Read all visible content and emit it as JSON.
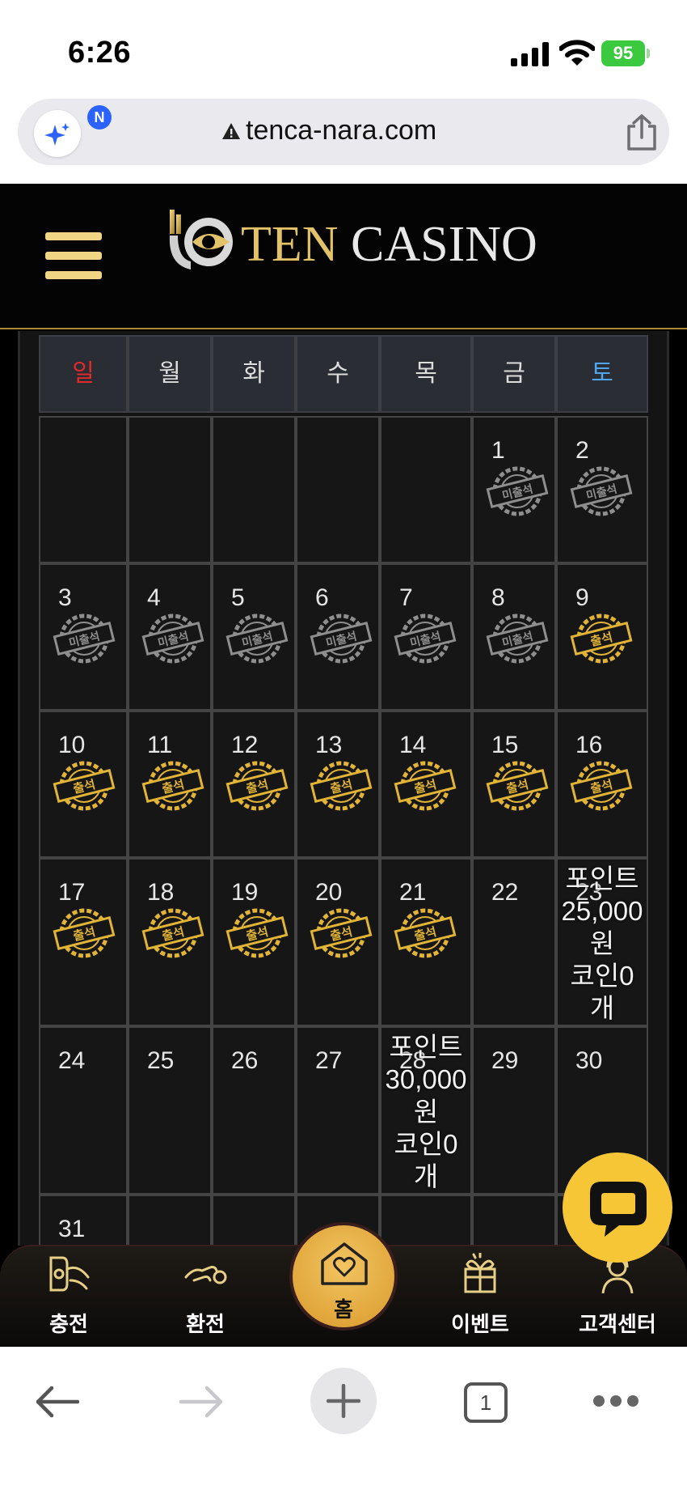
{
  "status_bar": {
    "time": "6:26",
    "battery": "95"
  },
  "browser": {
    "url": "tenca-nara.com",
    "ai_badge": "N"
  },
  "site": {
    "logo_ten": "TEN",
    "logo_casino": "CASINO"
  },
  "calendar": {
    "weekdays": [
      {
        "label": "일",
        "color": "#e02a2a"
      },
      {
        "label": "월",
        "color": "#dddddd"
      },
      {
        "label": "화",
        "color": "#dddddd"
      },
      {
        "label": "수",
        "color": "#dddddd"
      },
      {
        "label": "목",
        "color": "#dddddd"
      },
      {
        "label": "금",
        "color": "#dddddd"
      },
      {
        "label": "토",
        "color": "#4fa6ee"
      }
    ],
    "stamp_attended": "출석",
    "stamp_absent": "미출석",
    "weeks": [
      [
        {
          "day": ""
        },
        {
          "day": ""
        },
        {
          "day": ""
        },
        {
          "day": ""
        },
        {
          "day": ""
        },
        {
          "day": "1",
          "status": "absent"
        },
        {
          "day": "2",
          "status": "absent"
        }
      ],
      [
        {
          "day": "3",
          "status": "absent"
        },
        {
          "day": "4",
          "status": "absent"
        },
        {
          "day": "5",
          "status": "absent"
        },
        {
          "day": "6",
          "status": "absent"
        },
        {
          "day": "7",
          "status": "absent"
        },
        {
          "day": "8",
          "status": "absent"
        },
        {
          "day": "9",
          "status": "attended"
        }
      ],
      [
        {
          "day": "10",
          "status": "attended"
        },
        {
          "day": "11",
          "status": "attended"
        },
        {
          "day": "12",
          "status": "attended"
        },
        {
          "day": "13",
          "status": "attended"
        },
        {
          "day": "14",
          "status": "attended"
        },
        {
          "day": "15",
          "status": "attended"
        },
        {
          "day": "16",
          "status": "attended"
        }
      ],
      [
        {
          "day": "17",
          "status": "attended"
        },
        {
          "day": "18",
          "status": "attended"
        },
        {
          "day": "19",
          "status": "attended"
        },
        {
          "day": "20",
          "status": "attended"
        },
        {
          "day": "21",
          "status": "attended"
        },
        {
          "day": "22"
        },
        {
          "day": "23",
          "reward": [
            "포인트",
            "25,000",
            "원",
            "코인0",
            "개"
          ]
        }
      ],
      [
        {
          "day": "24"
        },
        {
          "day": "25"
        },
        {
          "day": "26"
        },
        {
          "day": "27"
        },
        {
          "day": "28",
          "reward": [
            "포인트",
            "30,000",
            "원",
            "코인0",
            "개"
          ]
        },
        {
          "day": "29"
        },
        {
          "day": "30"
        }
      ],
      [
        {
          "day": "31"
        },
        {
          "day": ""
        },
        {
          "day": ""
        },
        {
          "day": ""
        },
        {
          "day": ""
        },
        {
          "day": ""
        },
        {
          "day": ""
        }
      ]
    ]
  },
  "bottom_nav": {
    "charge": "충전",
    "exchange": "환전",
    "home": "홈",
    "event": "이벤트",
    "support": "고객센터"
  },
  "toolbar": {
    "tab_count": "1"
  },
  "colors": {
    "gold": "#f0d585",
    "stamp_gold": "#e2b436",
    "stamp_gray": "#8e8e8e",
    "chat_yellow": "#f7c636"
  }
}
